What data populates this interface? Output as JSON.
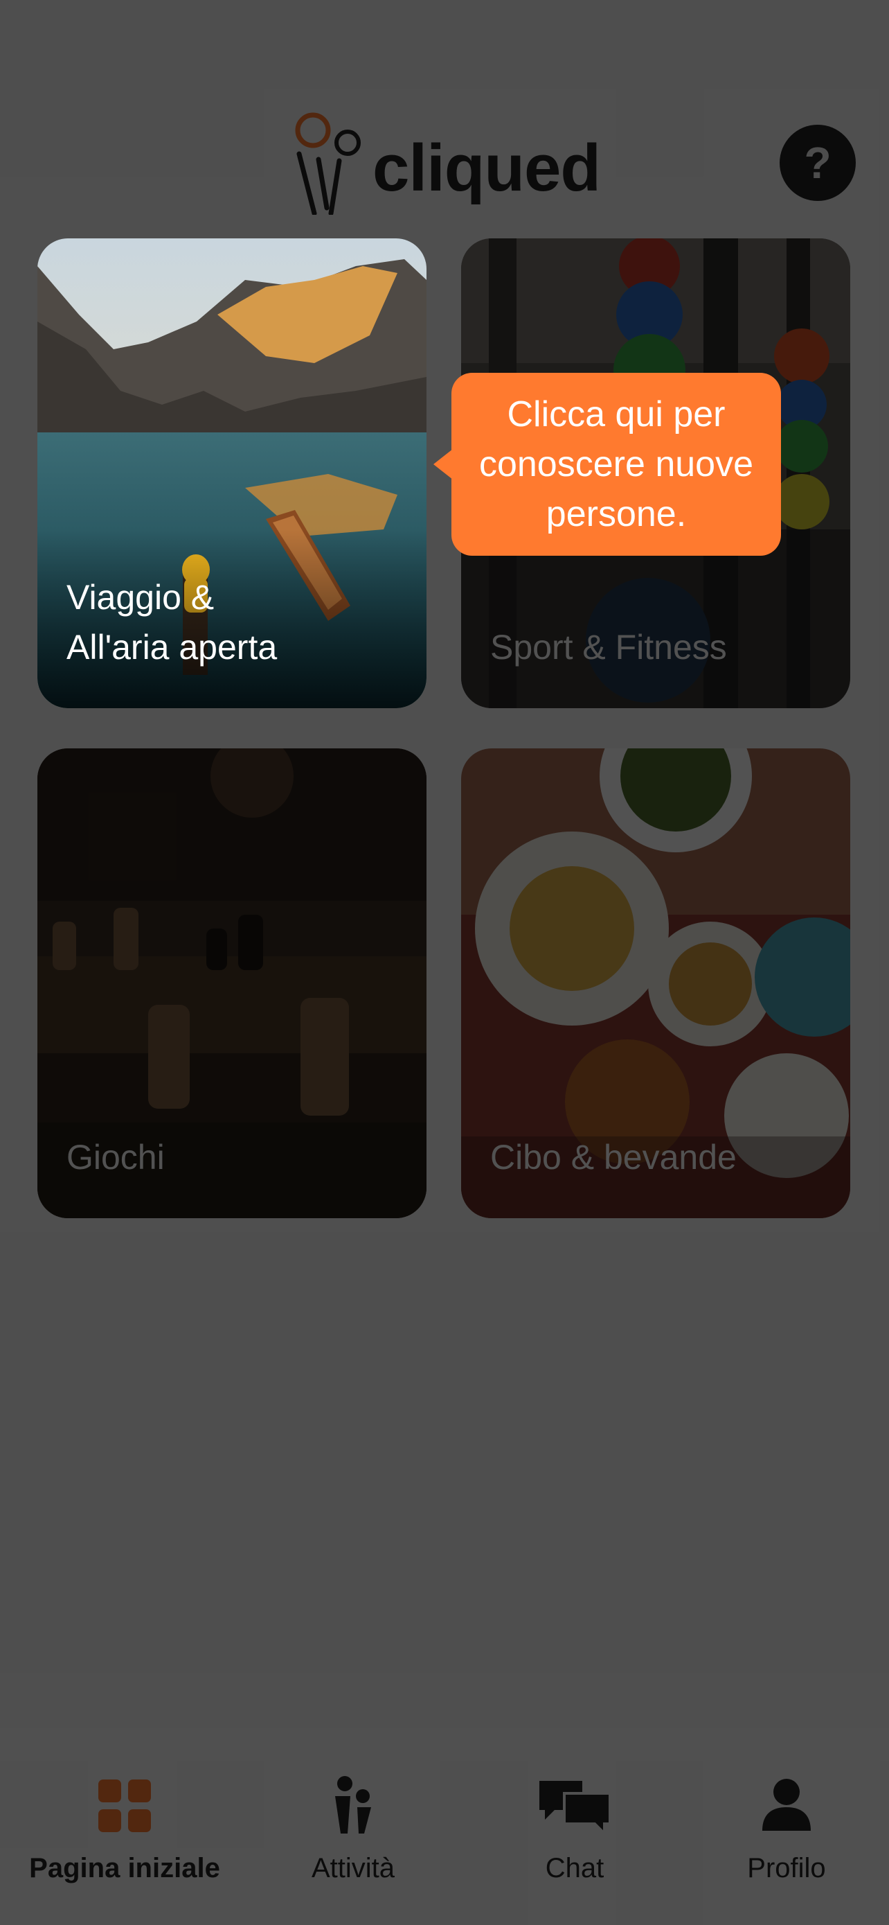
{
  "header": {
    "logo_text": "cliqued",
    "help_label": "?"
  },
  "categories": [
    {
      "label": "Viaggio &\nAll'aria aperta"
    },
    {
      "label": "Sport & Fitness"
    },
    {
      "label": "Giochi"
    },
    {
      "label": "Cibo & bevande"
    }
  ],
  "tooltip": {
    "text": "Clicca qui per\nconoscere nuove\npersone."
  },
  "tabbar": {
    "items": [
      {
        "label": "Pagina iniziale",
        "icon": "grid-icon",
        "active": true
      },
      {
        "label": "Attività",
        "icon": "people-icon",
        "active": false
      },
      {
        "label": "Chat",
        "icon": "chat-bubbles-icon",
        "active": false
      },
      {
        "label": "Profilo",
        "icon": "person-icon",
        "active": false
      }
    ]
  },
  "colors": {
    "accent": "#ff7a2f",
    "active_tab_icon": "#ff7a2f"
  }
}
